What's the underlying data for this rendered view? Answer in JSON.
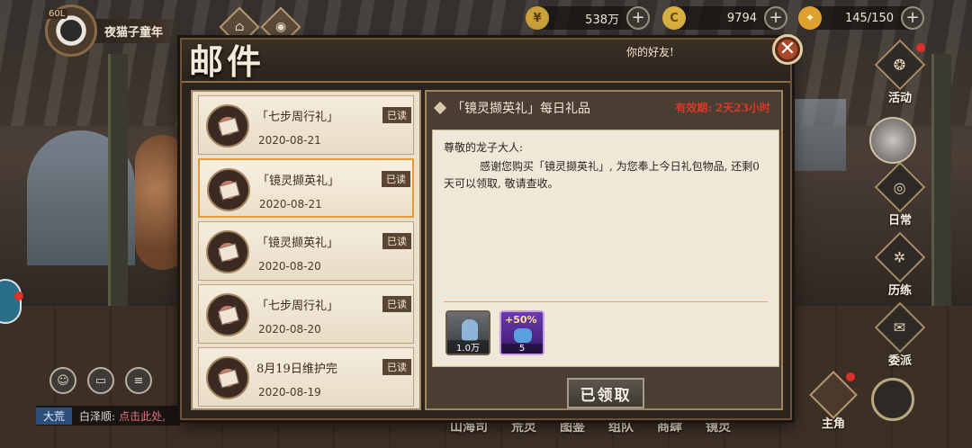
{
  "player": {
    "level": "60L",
    "name": "夜猫子童年"
  },
  "resources": [
    {
      "icon": "gold-coin-icon",
      "symbol": "¥",
      "value": "538万"
    },
    {
      "icon": "c-coin-icon",
      "symbol": "C",
      "value": "9794"
    },
    {
      "icon": "stamina-icon",
      "symbol": "✦",
      "value": "145/150"
    }
  ],
  "mail": {
    "title": "邮件",
    "subtitle": "你的好友!",
    "items": [
      {
        "title": "「七步周行礼」",
        "date": "2020-08-21",
        "status": "已读"
      },
      {
        "title": "「镜灵撷英礼」",
        "date": "2020-08-21",
        "status": "已读"
      },
      {
        "title": "「镜灵撷英礼」",
        "date": "2020-08-20",
        "status": "已读"
      },
      {
        "title": "「七步周行礼」",
        "date": "2020-08-20",
        "status": "已读"
      },
      {
        "title": "8月19日维护完",
        "date": "2020-08-19",
        "status": "已读"
      }
    ],
    "detail": {
      "subject": "「镜灵撷英礼」每日礼品",
      "validity": "有效期: 2天23小时",
      "greeting": "尊敬的龙子大人:",
      "content": "感谢您购买「镜灵撷英礼」, 为您奉上今日礼包物品, 还剩0天可以领取, 敬请查收。",
      "rewards": [
        {
          "icon": "potion-bottle-icon",
          "count": "1.0万"
        },
        {
          "icon": "exp-potion-icon",
          "bonus": "+50%",
          "count": "5"
        }
      ],
      "claim_label": "已领取"
    }
  },
  "side_menu": [
    {
      "label": "活动",
      "icon": "activity-icon"
    },
    {
      "label": "日常",
      "icon": "daily-icon"
    },
    {
      "label": "历练",
      "icon": "training-icon"
    },
    {
      "label": "委派",
      "icon": "dispatch-icon"
    }
  ],
  "chat": {
    "channel": "大荒",
    "speaker": "白泽顺:",
    "message": "点击此处,"
  },
  "bottom_nav": [
    "山海司",
    "荒灵",
    "图鉴",
    "组队",
    "商肆",
    "镜灵"
  ],
  "main_character_label": "主角",
  "colors": {
    "selected_border": "#e89a38",
    "validity": "#d83a28",
    "notify_dot": "#e0302a"
  }
}
